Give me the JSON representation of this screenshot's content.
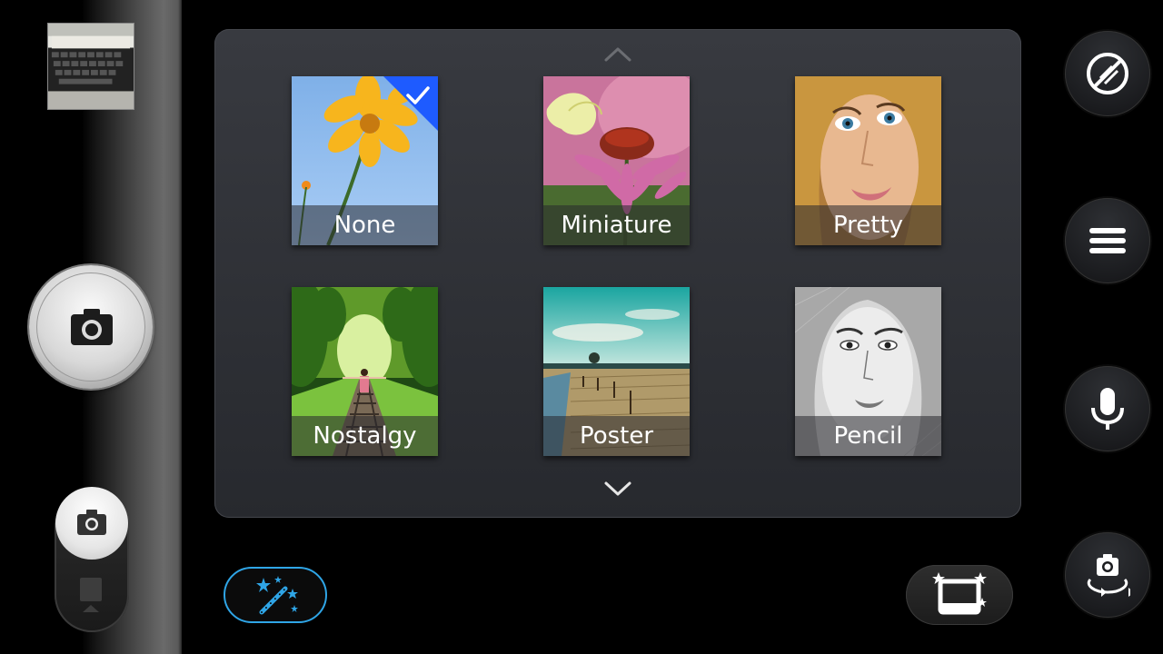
{
  "camera": {
    "effects": [
      {
        "id": "none",
        "label": "None",
        "selected": true
      },
      {
        "id": "miniature",
        "label": "Miniature",
        "selected": false
      },
      {
        "id": "pretty",
        "label": "Pretty",
        "selected": false
      },
      {
        "id": "nostalgy",
        "label": "Nostalgy",
        "selected": false
      },
      {
        "id": "poster",
        "label": "Poster",
        "selected": false
      },
      {
        "id": "pencil",
        "label": "Pencil",
        "selected": false
      }
    ],
    "left_controls": {
      "gallery_thumbnail": "gallery-thumbnail",
      "shutter_icon": "camera-icon",
      "mode_switch": {
        "current": "photo",
        "options": [
          "photo",
          "video"
        ]
      }
    },
    "bottom_controls": {
      "effects_icon": "magic-wand-icon",
      "frame_icon": "frame-sparkle-icon"
    },
    "right_controls": [
      "flash-off-icon",
      "menu-icon",
      "microphone-icon",
      "switch-camera-icon"
    ],
    "colors": {
      "selection": "#1e5bff",
      "effects_accent": "#2fa5e6",
      "panel": "#2e3035"
    }
  }
}
